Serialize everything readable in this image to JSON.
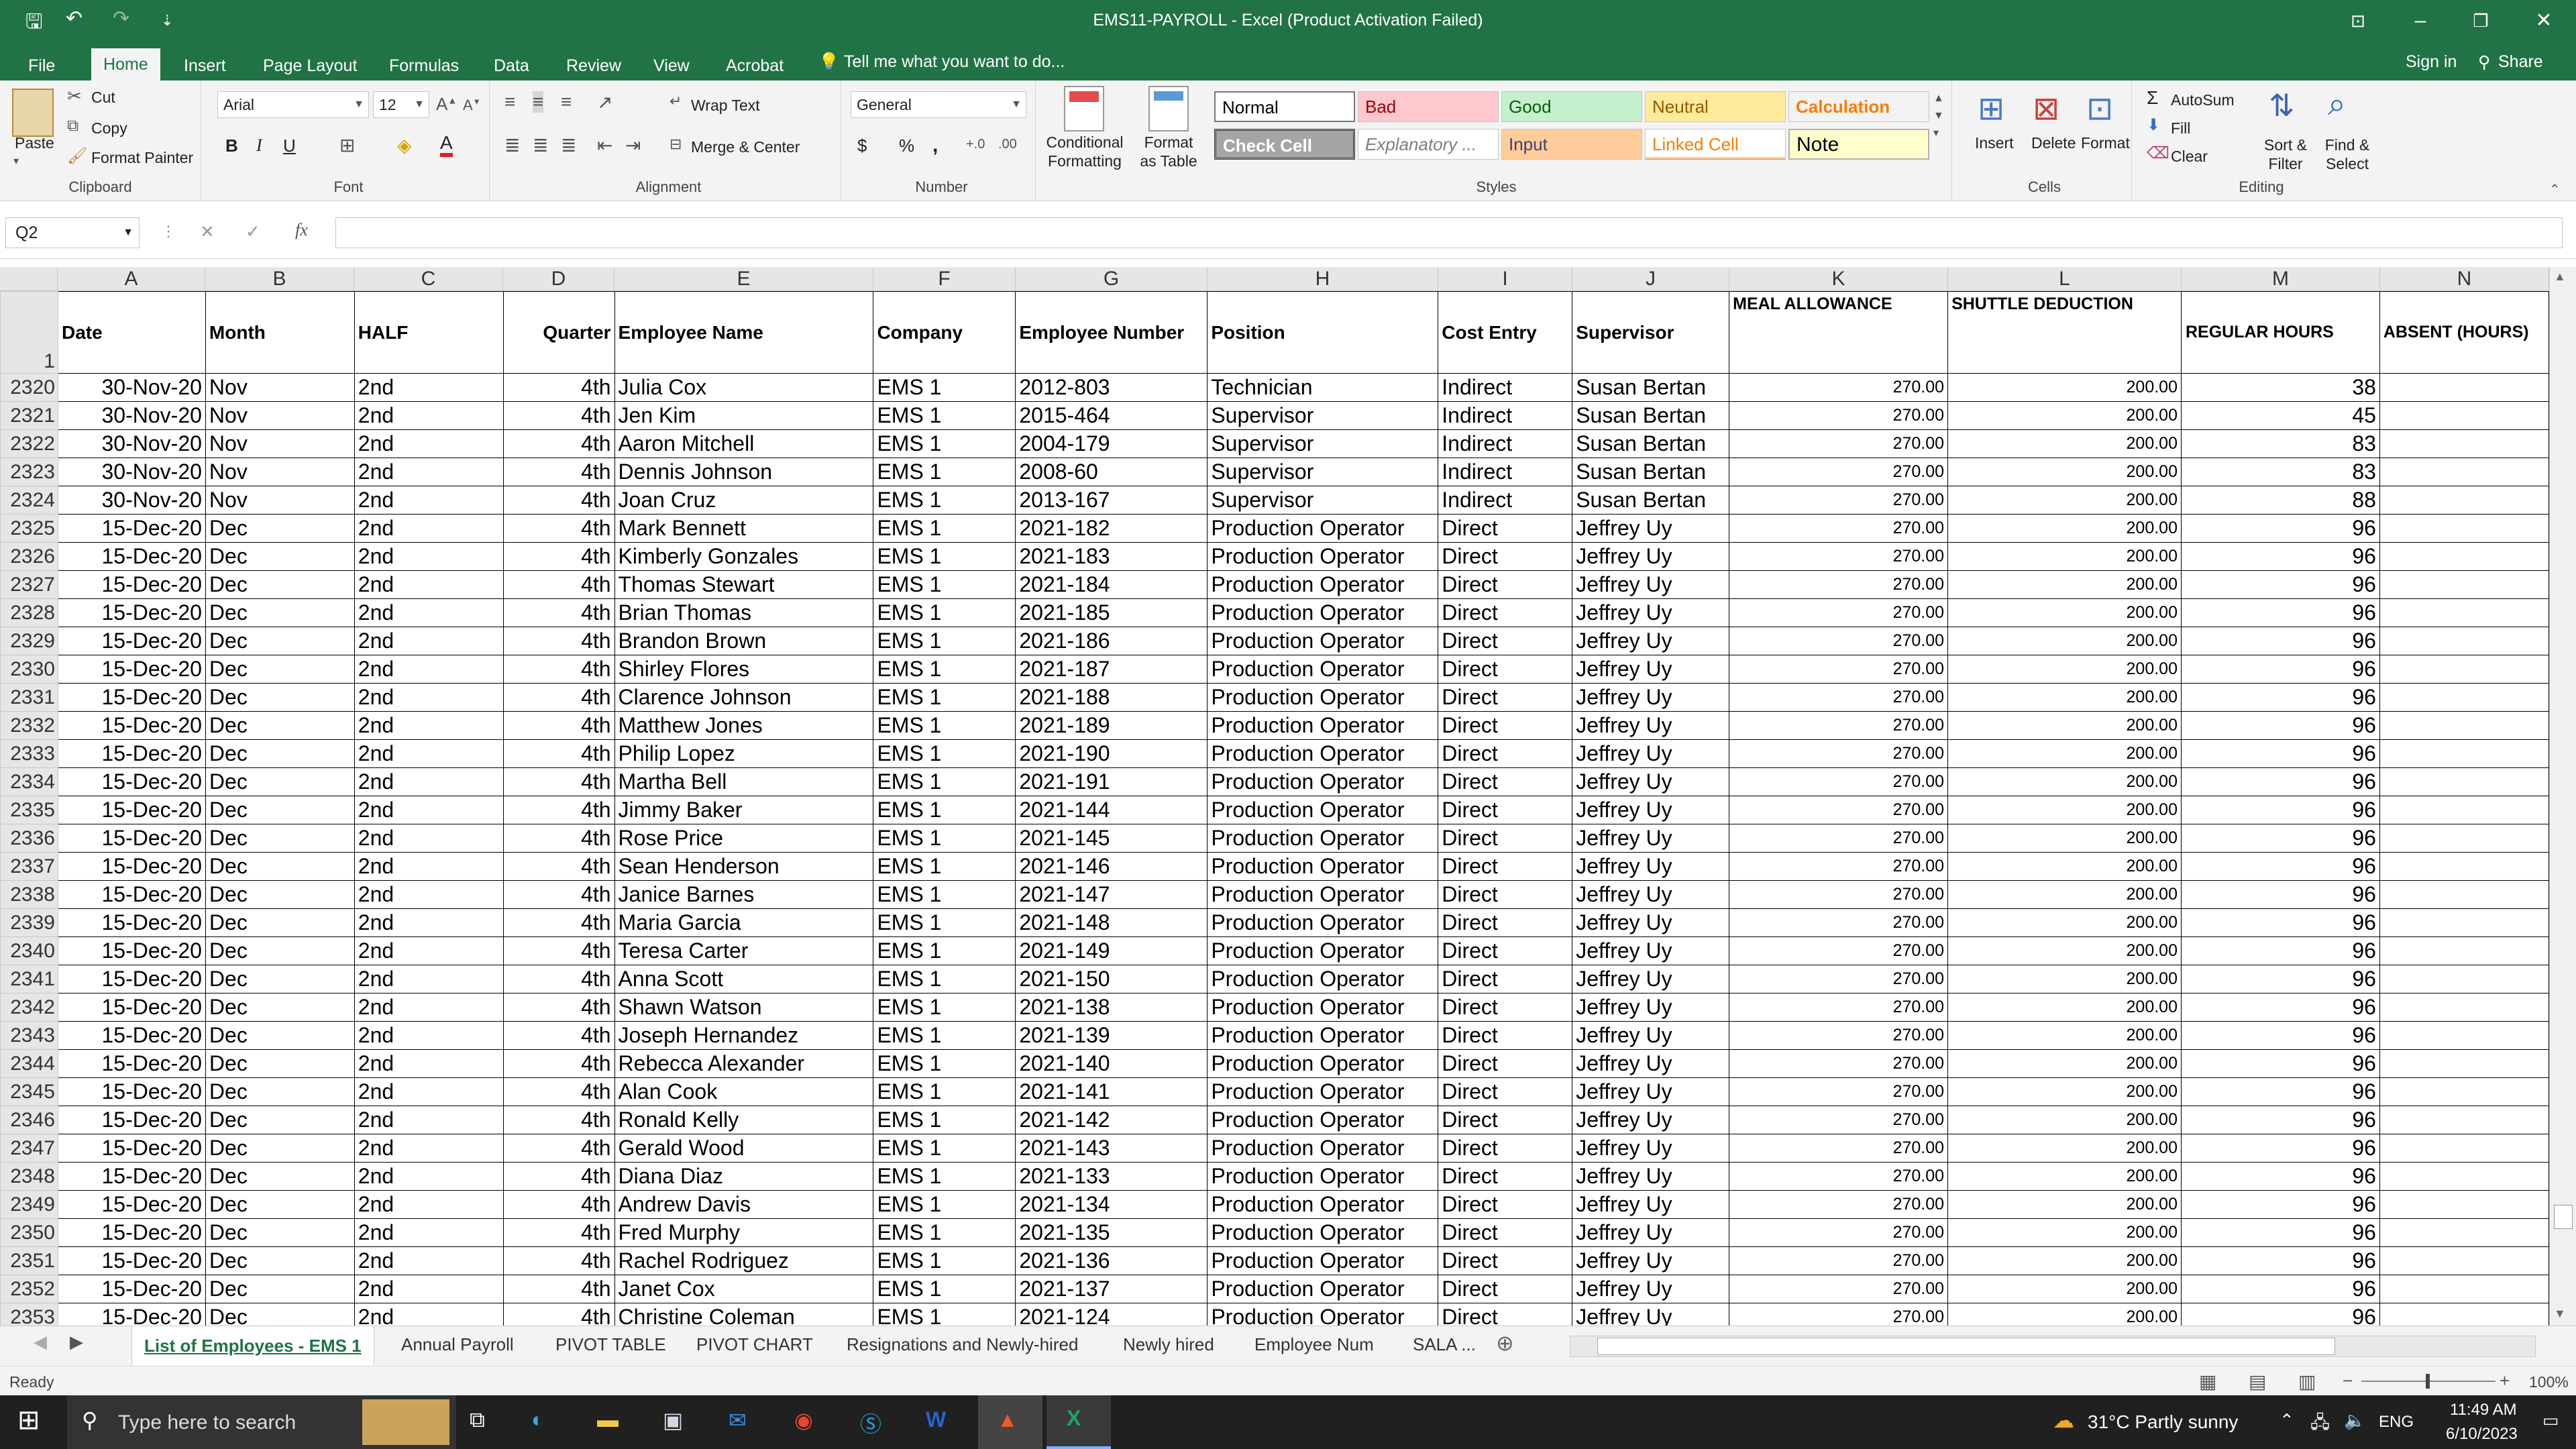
{
  "window": {
    "title": "EMS11-PAYROLL  -  Excel (Product Activation Failed)",
    "minimize": "–",
    "restore": "❐",
    "close": "✕",
    "ribbon_display": "⊡"
  },
  "quick_access": {
    "save": "🖫",
    "undo": "↶",
    "redo": "↷",
    "customize": "⇣"
  },
  "menu": {
    "tabs": [
      "File",
      "Home",
      "Insert",
      "Page Layout",
      "Formulas",
      "Data",
      "Review",
      "View",
      "Acrobat"
    ],
    "active": "Home",
    "tell_me": "Tell me what you want to do...",
    "sign_in": "Sign in",
    "share": "Share"
  },
  "ribbon": {
    "clipboard": {
      "label": "Clipboard",
      "paste": "Paste",
      "cut": "Cut",
      "copy": "Copy",
      "format_painter": "Format Painter"
    },
    "font": {
      "label": "Font",
      "name": "Arial",
      "size": "12",
      "bold": "B",
      "italic": "I",
      "underline": "U"
    },
    "alignment": {
      "label": "Alignment",
      "wrap": "Wrap Text",
      "merge": "Merge & Center"
    },
    "number": {
      "label": "Number",
      "format": "General",
      "currency": "$",
      "percent": "%",
      "comma": ","
    },
    "styles": {
      "label": "Styles",
      "conditional": "Conditional Formatting",
      "format_table": "Format as Table",
      "items": [
        {
          "name": "Normal",
          "bg": "#ffffff",
          "fg": "#000000"
        },
        {
          "name": "Bad",
          "bg": "#ffc7ce",
          "fg": "#9c0006"
        },
        {
          "name": "Good",
          "bg": "#c6efce",
          "fg": "#006100"
        },
        {
          "name": "Neutral",
          "bg": "#ffeb9c",
          "fg": "#9c5700"
        },
        {
          "name": "Calculation",
          "bg": "#f2f2f2",
          "fg": "#fa7d00"
        },
        {
          "name": "Check Cell",
          "bg": "#a5a5a5",
          "fg": "#ffffff"
        },
        {
          "name": "Explanatory ...",
          "bg": "#ffffff",
          "fg": "#7f7f7f"
        },
        {
          "name": "Input",
          "bg": "#ffcc99",
          "fg": "#3f3f76"
        },
        {
          "name": "Linked Cell",
          "bg": "#ffffff",
          "fg": "#fa7d00"
        },
        {
          "name": "Note",
          "bg": "#ffffcc",
          "fg": "#000000"
        }
      ]
    },
    "cells": {
      "label": "Cells",
      "insert": "Insert",
      "delete": "Delete",
      "format": "Format"
    },
    "editing": {
      "label": "Editing",
      "autosum": "AutoSum",
      "fill": "Fill",
      "clear": "Clear",
      "sort": "Sort & Filter",
      "find": "Find & Select"
    }
  },
  "formula_bar": {
    "name_box": "Q2",
    "fx": "fx",
    "cancel": "✕",
    "enter": "✓",
    "value": ""
  },
  "columns": [
    "A",
    "B",
    "C",
    "D",
    "E",
    "F",
    "G",
    "H",
    "I",
    "J",
    "K",
    "L",
    "M",
    "N"
  ],
  "header_row": {
    "row_num": "1",
    "cells": [
      "Date",
      "Month",
      "HALF",
      "Quarter",
      "Employee Name",
      "Company",
      "Employee Number",
      "Position",
      "Cost Entry",
      "Supervisor",
      "MEAL ALLOWANCE",
      "SHUTTLE DEDUCTION",
      "REGULAR HOURS",
      "ABSENT (HOURS)"
    ]
  },
  "rows": [
    [
      "2320",
      "30-Nov-20",
      "Nov",
      "2nd",
      "4th",
      "Julia Cox",
      "EMS 1",
      "2012-803",
      "Technician",
      "Indirect",
      "Susan Bertan",
      "270.00",
      "200.00",
      "38",
      ""
    ],
    [
      "2321",
      "30-Nov-20",
      "Nov",
      "2nd",
      "4th",
      "Jen Kim",
      "EMS 1",
      "2015-464",
      "Supervisor",
      "Indirect",
      "Susan Bertan",
      "270.00",
      "200.00",
      "45",
      ""
    ],
    [
      "2322",
      "30-Nov-20",
      "Nov",
      "2nd",
      "4th",
      "Aaron Mitchell",
      "EMS 1",
      "2004-179",
      "Supervisor",
      "Indirect",
      "Susan Bertan",
      "270.00",
      "200.00",
      "83",
      ""
    ],
    [
      "2323",
      "30-Nov-20",
      "Nov",
      "2nd",
      "4th",
      "Dennis Johnson",
      "EMS 1",
      "2008-60",
      "Supervisor",
      "Indirect",
      "Susan Bertan",
      "270.00",
      "200.00",
      "83",
      ""
    ],
    [
      "2324",
      "30-Nov-20",
      "Nov",
      "2nd",
      "4th",
      "Joan Cruz",
      "EMS 1",
      "2013-167",
      "Supervisor",
      "Indirect",
      "Susan Bertan",
      "270.00",
      "200.00",
      "88",
      ""
    ],
    [
      "2325",
      "15-Dec-20",
      "Dec",
      "2nd",
      "4th",
      "Mark Bennett",
      "EMS 1",
      "2021-182",
      "Production Operator",
      "Direct",
      "Jeffrey Uy",
      "270.00",
      "200.00",
      "96",
      ""
    ],
    [
      "2326",
      "15-Dec-20",
      "Dec",
      "2nd",
      "4th",
      "Kimberly Gonzales",
      "EMS 1",
      "2021-183",
      "Production Operator",
      "Direct",
      "Jeffrey Uy",
      "270.00",
      "200.00",
      "96",
      ""
    ],
    [
      "2327",
      "15-Dec-20",
      "Dec",
      "2nd",
      "4th",
      "Thomas Stewart",
      "EMS 1",
      "2021-184",
      "Production Operator",
      "Direct",
      "Jeffrey Uy",
      "270.00",
      "200.00",
      "96",
      ""
    ],
    [
      "2328",
      "15-Dec-20",
      "Dec",
      "2nd",
      "4th",
      "Brian Thomas",
      "EMS 1",
      "2021-185",
      "Production Operator",
      "Direct",
      "Jeffrey Uy",
      "270.00",
      "200.00",
      "96",
      ""
    ],
    [
      "2329",
      "15-Dec-20",
      "Dec",
      "2nd",
      "4th",
      "Brandon Brown",
      "EMS 1",
      "2021-186",
      "Production Operator",
      "Direct",
      "Jeffrey Uy",
      "270.00",
      "200.00",
      "96",
      ""
    ],
    [
      "2330",
      "15-Dec-20",
      "Dec",
      "2nd",
      "4th",
      "Shirley Flores",
      "EMS 1",
      "2021-187",
      "Production Operator",
      "Direct",
      "Jeffrey Uy",
      "270.00",
      "200.00",
      "96",
      ""
    ],
    [
      "2331",
      "15-Dec-20",
      "Dec",
      "2nd",
      "4th",
      "Clarence Johnson",
      "EMS 1",
      "2021-188",
      "Production Operator",
      "Direct",
      "Jeffrey Uy",
      "270.00",
      "200.00",
      "96",
      ""
    ],
    [
      "2332",
      "15-Dec-20",
      "Dec",
      "2nd",
      "4th",
      "Matthew Jones",
      "EMS 1",
      "2021-189",
      "Production Operator",
      "Direct",
      "Jeffrey Uy",
      "270.00",
      "200.00",
      "96",
      ""
    ],
    [
      "2333",
      "15-Dec-20",
      "Dec",
      "2nd",
      "4th",
      "Philip Lopez",
      "EMS 1",
      "2021-190",
      "Production Operator",
      "Direct",
      "Jeffrey Uy",
      "270.00",
      "200.00",
      "96",
      ""
    ],
    [
      "2334",
      "15-Dec-20",
      "Dec",
      "2nd",
      "4th",
      "Martha Bell",
      "EMS 1",
      "2021-191",
      "Production Operator",
      "Direct",
      "Jeffrey Uy",
      "270.00",
      "200.00",
      "96",
      ""
    ],
    [
      "2335",
      "15-Dec-20",
      "Dec",
      "2nd",
      "4th",
      "Jimmy Baker",
      "EMS 1",
      "2021-144",
      "Production Operator",
      "Direct",
      "Jeffrey Uy",
      "270.00",
      "200.00",
      "96",
      ""
    ],
    [
      "2336",
      "15-Dec-20",
      "Dec",
      "2nd",
      "4th",
      "Rose Price",
      "EMS 1",
      "2021-145",
      "Production Operator",
      "Direct",
      "Jeffrey Uy",
      "270.00",
      "200.00",
      "96",
      ""
    ],
    [
      "2337",
      "15-Dec-20",
      "Dec",
      "2nd",
      "4th",
      "Sean Henderson",
      "EMS 1",
      "2021-146",
      "Production Operator",
      "Direct",
      "Jeffrey Uy",
      "270.00",
      "200.00",
      "96",
      ""
    ],
    [
      "2338",
      "15-Dec-20",
      "Dec",
      "2nd",
      "4th",
      "Janice Barnes",
      "EMS 1",
      "2021-147",
      "Production Operator",
      "Direct",
      "Jeffrey Uy",
      "270.00",
      "200.00",
      "96",
      ""
    ],
    [
      "2339",
      "15-Dec-20",
      "Dec",
      "2nd",
      "4th",
      "Maria Garcia",
      "EMS 1",
      "2021-148",
      "Production Operator",
      "Direct",
      "Jeffrey Uy",
      "270.00",
      "200.00",
      "96",
      ""
    ],
    [
      "2340",
      "15-Dec-20",
      "Dec",
      "2nd",
      "4th",
      "Teresa Carter",
      "EMS 1",
      "2021-149",
      "Production Operator",
      "Direct",
      "Jeffrey Uy",
      "270.00",
      "200.00",
      "96",
      ""
    ],
    [
      "2341",
      "15-Dec-20",
      "Dec",
      "2nd",
      "4th",
      "Anna Scott",
      "EMS 1",
      "2021-150",
      "Production Operator",
      "Direct",
      "Jeffrey Uy",
      "270.00",
      "200.00",
      "96",
      ""
    ],
    [
      "2342",
      "15-Dec-20",
      "Dec",
      "2nd",
      "4th",
      "Shawn Watson",
      "EMS 1",
      "2021-138",
      "Production Operator",
      "Direct",
      "Jeffrey Uy",
      "270.00",
      "200.00",
      "96",
      ""
    ],
    [
      "2343",
      "15-Dec-20",
      "Dec",
      "2nd",
      "4th",
      "Joseph Hernandez",
      "EMS 1",
      "2021-139",
      "Production Operator",
      "Direct",
      "Jeffrey Uy",
      "270.00",
      "200.00",
      "96",
      ""
    ],
    [
      "2344",
      "15-Dec-20",
      "Dec",
      "2nd",
      "4th",
      "Rebecca Alexander",
      "EMS 1",
      "2021-140",
      "Production Operator",
      "Direct",
      "Jeffrey Uy",
      "270.00",
      "200.00",
      "96",
      ""
    ],
    [
      "2345",
      "15-Dec-20",
      "Dec",
      "2nd",
      "4th",
      "Alan Cook",
      "EMS 1",
      "2021-141",
      "Production Operator",
      "Direct",
      "Jeffrey Uy",
      "270.00",
      "200.00",
      "96",
      ""
    ],
    [
      "2346",
      "15-Dec-20",
      "Dec",
      "2nd",
      "4th",
      "Ronald Kelly",
      "EMS 1",
      "2021-142",
      "Production Operator",
      "Direct",
      "Jeffrey Uy",
      "270.00",
      "200.00",
      "96",
      ""
    ],
    [
      "2347",
      "15-Dec-20",
      "Dec",
      "2nd",
      "4th",
      "Gerald Wood",
      "EMS 1",
      "2021-143",
      "Production Operator",
      "Direct",
      "Jeffrey Uy",
      "270.00",
      "200.00",
      "96",
      ""
    ],
    [
      "2348",
      "15-Dec-20",
      "Dec",
      "2nd",
      "4th",
      "Diana Diaz",
      "EMS 1",
      "2021-133",
      "Production Operator",
      "Direct",
      "Jeffrey Uy",
      "270.00",
      "200.00",
      "96",
      ""
    ],
    [
      "2349",
      "15-Dec-20",
      "Dec",
      "2nd",
      "4th",
      "Andrew Davis",
      "EMS 1",
      "2021-134",
      "Production Operator",
      "Direct",
      "Jeffrey Uy",
      "270.00",
      "200.00",
      "96",
      ""
    ],
    [
      "2350",
      "15-Dec-20",
      "Dec",
      "2nd",
      "4th",
      "Fred Murphy",
      "EMS 1",
      "2021-135",
      "Production Operator",
      "Direct",
      "Jeffrey Uy",
      "270.00",
      "200.00",
      "96",
      ""
    ],
    [
      "2351",
      "15-Dec-20",
      "Dec",
      "2nd",
      "4th",
      "Rachel Rodriguez",
      "EMS 1",
      "2021-136",
      "Production Operator",
      "Direct",
      "Jeffrey Uy",
      "270.00",
      "200.00",
      "96",
      ""
    ],
    [
      "2352",
      "15-Dec-20",
      "Dec",
      "2nd",
      "4th",
      "Janet Cox",
      "EMS 1",
      "2021-137",
      "Production Operator",
      "Direct",
      "Jeffrey Uy",
      "270.00",
      "200.00",
      "96",
      ""
    ],
    [
      "2353",
      "15-Dec-20",
      "Dec",
      "2nd",
      "4th",
      "Christine Coleman",
      "EMS 1",
      "2021-124",
      "Production Operator",
      "Direct",
      "Jeffrey Uy",
      "270.00",
      "200.00",
      "96",
      ""
    ]
  ],
  "sheet_tabs": {
    "items": [
      "List of Employees - EMS 1",
      "Annual Payroll",
      "PIVOT TABLE",
      "PIVOT CHART",
      "Resignations and Newly-hired",
      "Newly hired",
      "Employee Num",
      "SALA ..."
    ],
    "active": "List of Employees - EMS 1",
    "add": "⊕"
  },
  "status": {
    "ready": "Ready",
    "zoom": "100%"
  },
  "taskbar": {
    "search_placeholder": "Type here to search",
    "weather": "31°C  Partly sunny",
    "lang": "ENG",
    "time": "11:49 AM",
    "date": "6/10/2023"
  }
}
